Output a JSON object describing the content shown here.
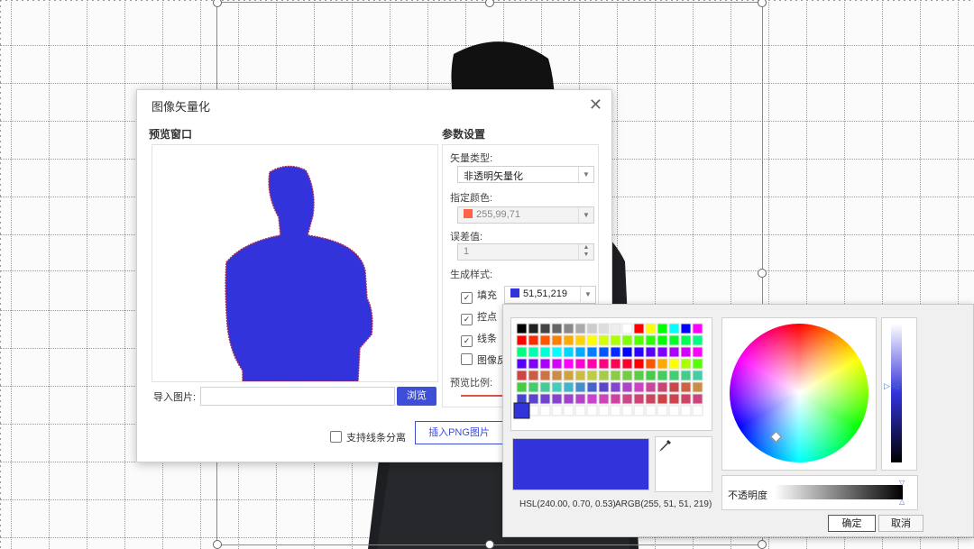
{
  "dialog": {
    "title": "图像矢量化",
    "preview_title": "预览窗口",
    "params_title": "参数设置",
    "vector_type_label": "矢量类型:",
    "vector_type_value": "非透明矢量化",
    "color_label": "指定颜色:",
    "color_value": "255,99,71",
    "error_label": "误差值:",
    "error_value": "1",
    "style_label": "生成样式:",
    "fill_label": "填充",
    "fill_value": "51,51,219",
    "control_label": "控点",
    "line_label": "线条",
    "invert_label": "图像反",
    "scale_label": "预览比例:",
    "import_label": "导入图片:",
    "browse_label": "浏览",
    "split_label": "支持线条分离",
    "insert_label": "插入PNG图片"
  },
  "picker": {
    "hsl": "HSL(240.00, 0.70, 0.53)",
    "argb": "ARGB(255, 51, 51, 219)",
    "opacity_label": "不透明度",
    "ok_label": "确定",
    "cancel_label": "取消",
    "selected_color": "#3333db"
  },
  "colors": {
    "fill": "#3333db",
    "tomato": "#ff6347",
    "accent": "#3d4ed8"
  }
}
